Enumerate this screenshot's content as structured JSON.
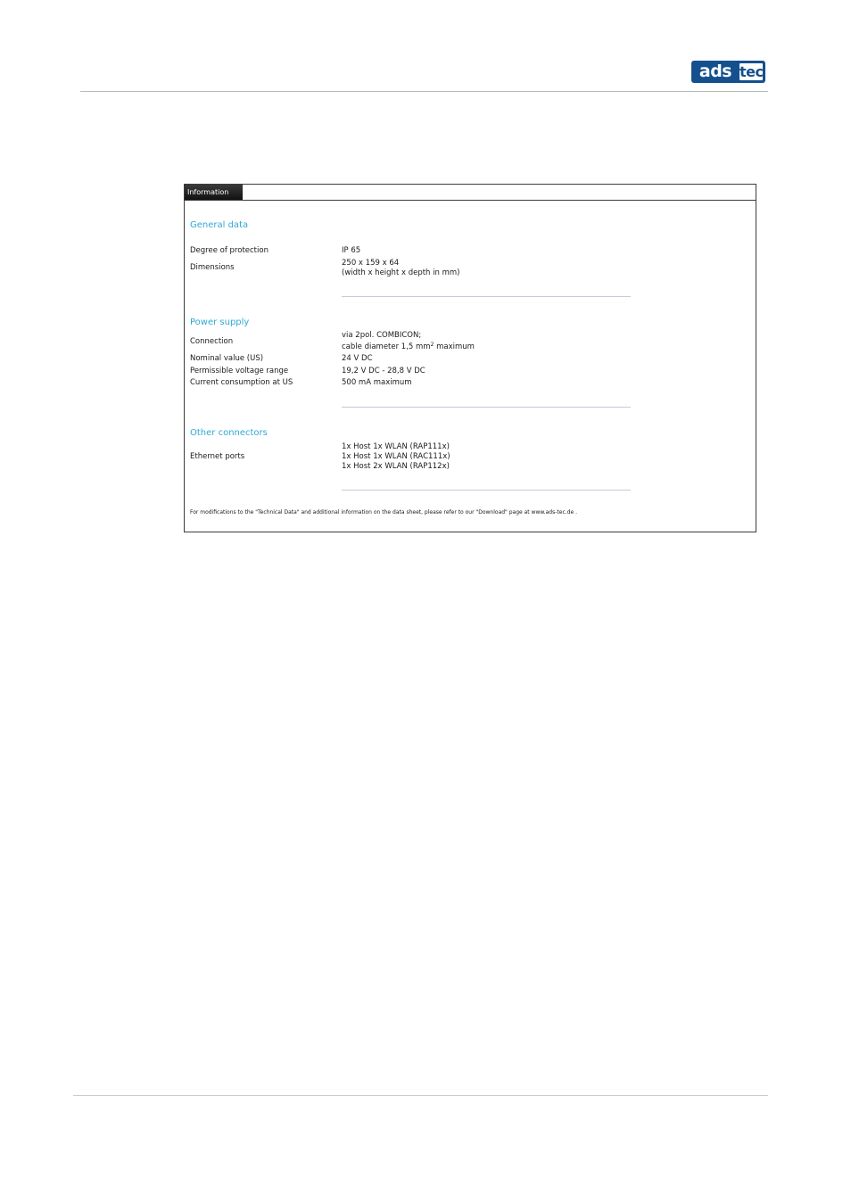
{
  "header": {
    "logo": {
      "left": "ads",
      "right": "tec"
    }
  },
  "panel": {
    "tab_label": "Information",
    "sections": {
      "general": {
        "title": "General data",
        "rows": [
          {
            "label": "Degree of protection",
            "value": "IP 65"
          },
          {
            "label": "Dimensions",
            "value_lines": [
              "250 x 159 x 64",
              "(width x height x depth in mm)"
            ]
          }
        ]
      },
      "power": {
        "title": "Power supply",
        "rows": [
          {
            "label": "Connection",
            "value_lines": [
              "via 2pol. COMBICON;",
              "cable diameter 1,5 mm",
              "2",
              " maximum"
            ]
          },
          {
            "label": "Nominal value (US)",
            "value": "24 V DC"
          },
          {
            "label": "Permissible voltage range",
            "value": "19,2 V DC - 28,8 V DC"
          },
          {
            "label": "Current consumption at US",
            "value": "500 mA maximum"
          }
        ]
      },
      "connectors": {
        "title": "Other connectors",
        "rows": [
          {
            "label": "Ethernet ports",
            "value_lines": [
              "1x Host 1x WLAN (RAP111x)",
              "1x Host 1x WLAN (RAC111x)",
              "1x Host 2x WLAN (RAP112x)"
            ]
          }
        ]
      }
    },
    "footnote": "For modifications to the \"Technical Data\" and additional information on the data sheet, please refer to our \"Download\" page at www.ads-tec.de ."
  }
}
